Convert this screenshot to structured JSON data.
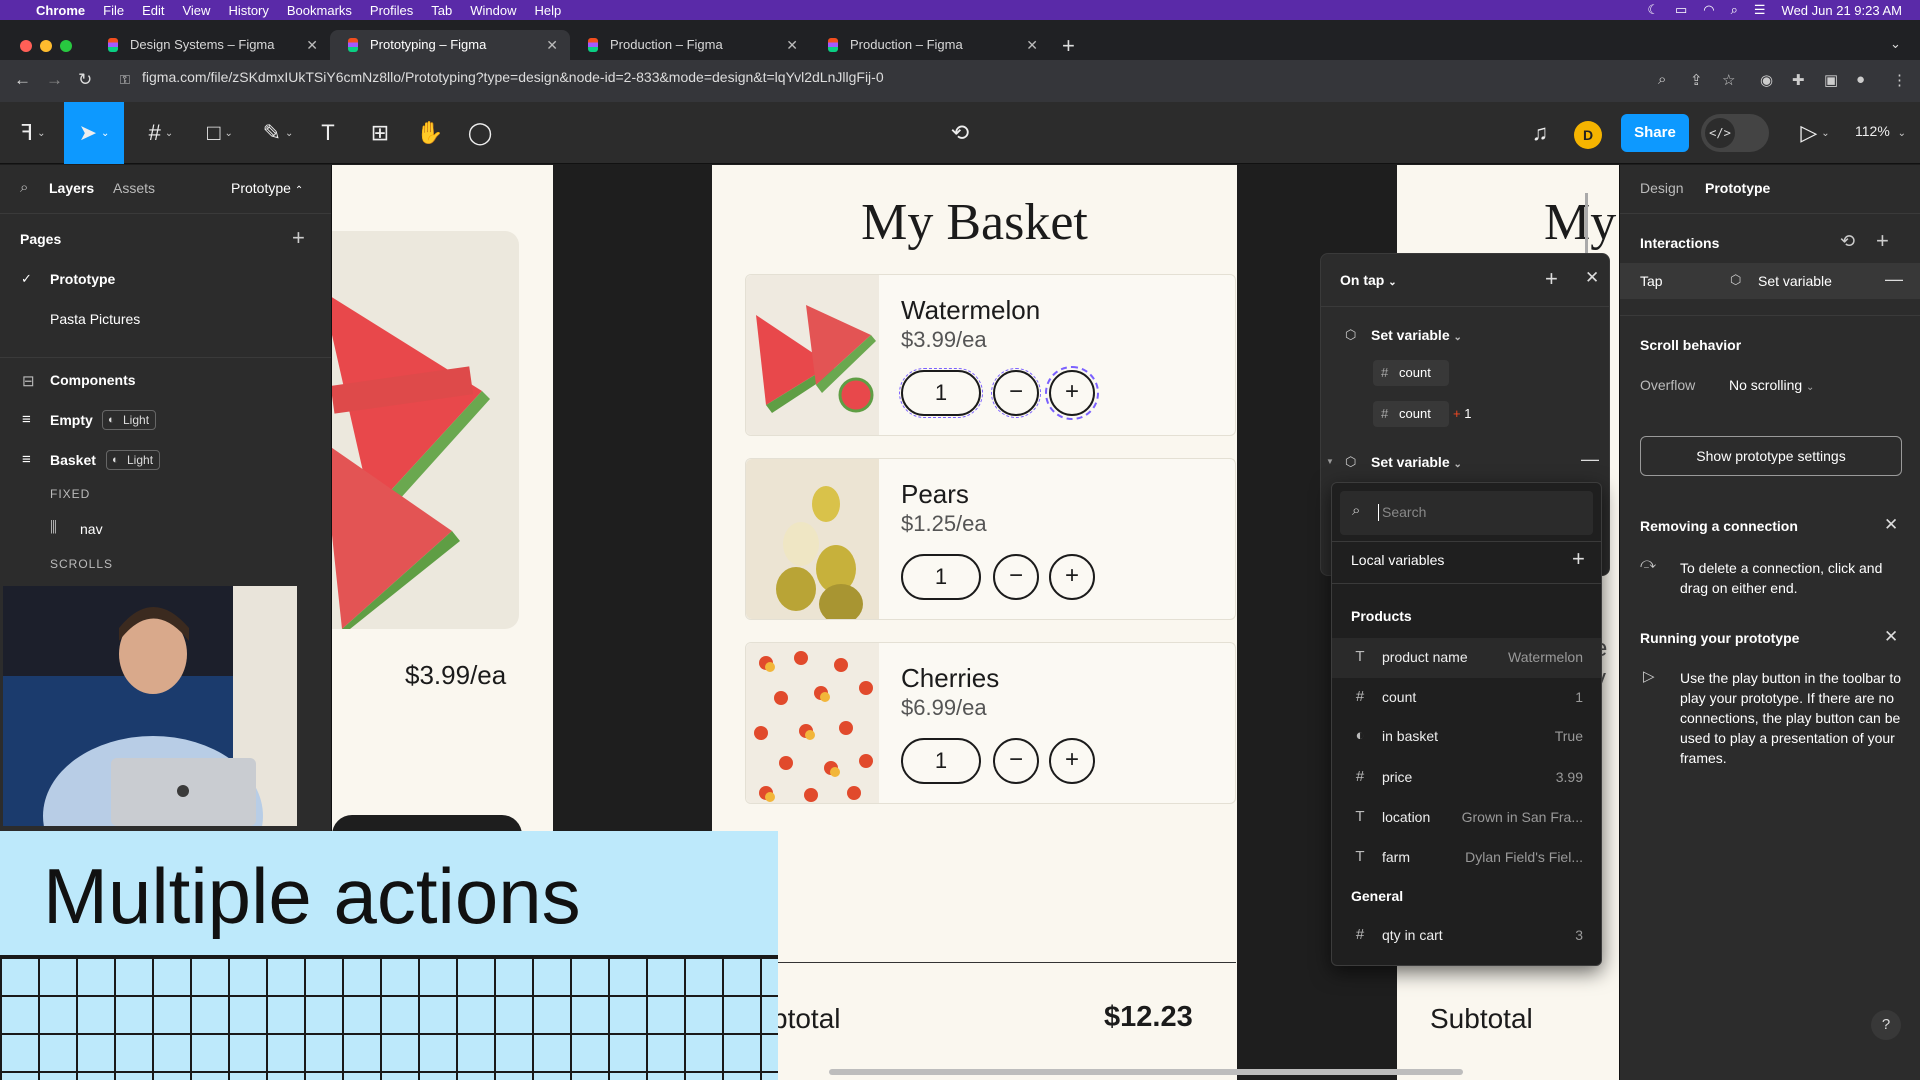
{
  "menubar": {
    "app": "Chrome",
    "items": [
      "File",
      "Edit",
      "View",
      "History",
      "Bookmarks",
      "Profiles",
      "Tab",
      "Window",
      "Help"
    ],
    "clock": "Wed Jun 21  9:23 AM"
  },
  "browser": {
    "tabs": [
      {
        "title": "Design Systems – Figma",
        "active": false
      },
      {
        "title": "Prototyping – Figma",
        "active": true
      },
      {
        "title": "Production – Figma",
        "active": false
      },
      {
        "title": "Production – Figma",
        "active": false
      }
    ],
    "url": "figma.com/file/zSKdmxIUkTSiY6cmNz8llo/Prototyping?type=design&node-id=2-833&mode=design&t=lqYvl2dLnJllgFij-0"
  },
  "toolbar": {
    "share_label": "Share",
    "avatar_initial": "D",
    "devmode_glyph": "</>",
    "zoom": "112%"
  },
  "left_panel": {
    "tabs": {
      "layers": "Layers",
      "assets": "Assets",
      "page_selector": "Prototype"
    },
    "pages_title": "Pages",
    "pages": [
      {
        "name": "Prototype",
        "current": true
      },
      {
        "name": "Pasta Pictures",
        "current": false
      }
    ],
    "layers": [
      {
        "name": "Components",
        "chip": ""
      },
      {
        "name": "Empty",
        "chip": "Light"
      },
      {
        "name": "Basket",
        "chip": "Light"
      }
    ],
    "section_fixed": "FIXED",
    "nav_layer": "nav",
    "section_scrolls": "SCROLLS"
  },
  "canvas": {
    "left_frame_price": "$3.99/ea",
    "basket_title": "My Basket",
    "right_frame_title": "My",
    "products": [
      {
        "name": "Watermelon",
        "price": "$3.99/ea",
        "qty": "1"
      },
      {
        "name": "Pears",
        "price": "$1.25/ea",
        "qty": "1"
      },
      {
        "name": "Cherries",
        "price": "$6.99/ea",
        "qty": "1"
      }
    ],
    "subtotal_label_partial": "btotal",
    "subtotal_value": "$12.23",
    "right_subtotal_label": "Subtotal",
    "right_frame_partial": "e",
    "right_frame_partial2": "y"
  },
  "interaction_popover": {
    "trigger": "On tap",
    "action1": "Set variable",
    "action1_target": "count",
    "action1_expr_var": "count",
    "action1_expr_op": "+ 1",
    "action2": "Set variable"
  },
  "variable_dropdown": {
    "search_placeholder": "Search",
    "local_title": "Local variables",
    "group_products": "Products",
    "products": [
      {
        "type": "T",
        "name": "product name",
        "value": "Watermelon"
      },
      {
        "type": "#",
        "name": "count",
        "value": "1"
      },
      {
        "type": "bool",
        "name": "in basket",
        "value": "True"
      },
      {
        "type": "#",
        "name": "price",
        "value": "3.99"
      },
      {
        "type": "T",
        "name": "location",
        "value": "Grown in San Fra..."
      },
      {
        "type": "T",
        "name": "farm",
        "value": "Dylan Field's Fiel..."
      }
    ],
    "group_general": "General",
    "general": [
      {
        "type": "#",
        "name": "qty in cart",
        "value": "3"
      }
    ]
  },
  "right_panel": {
    "tabs": {
      "design": "Design",
      "prototype": "Prototype"
    },
    "interactions_title": "Interactions",
    "interaction": {
      "trigger": "Tap",
      "action": "Set variable"
    },
    "scroll_title": "Scroll behavior",
    "overflow_label": "Overflow",
    "overflow_value": "No scrolling",
    "settings_button": "Show prototype settings",
    "tip1_title": "Removing a connection",
    "tip1_body": "To delete a connection, click and drag on either end.",
    "tip2_title": "Running your prototype",
    "tip2_body": "Use the play button in the toolbar to play your prototype. If there are no connections, the play button can be used to play a presentation of your frames.",
    "help": "?"
  },
  "overlay": {
    "title": "Multiple actions"
  },
  "colors": {
    "menubar": "#5a2aa8",
    "figma_blue": "#0d99ff",
    "title_card": "#bde9fb",
    "frame_bg": "#faf7ef"
  }
}
